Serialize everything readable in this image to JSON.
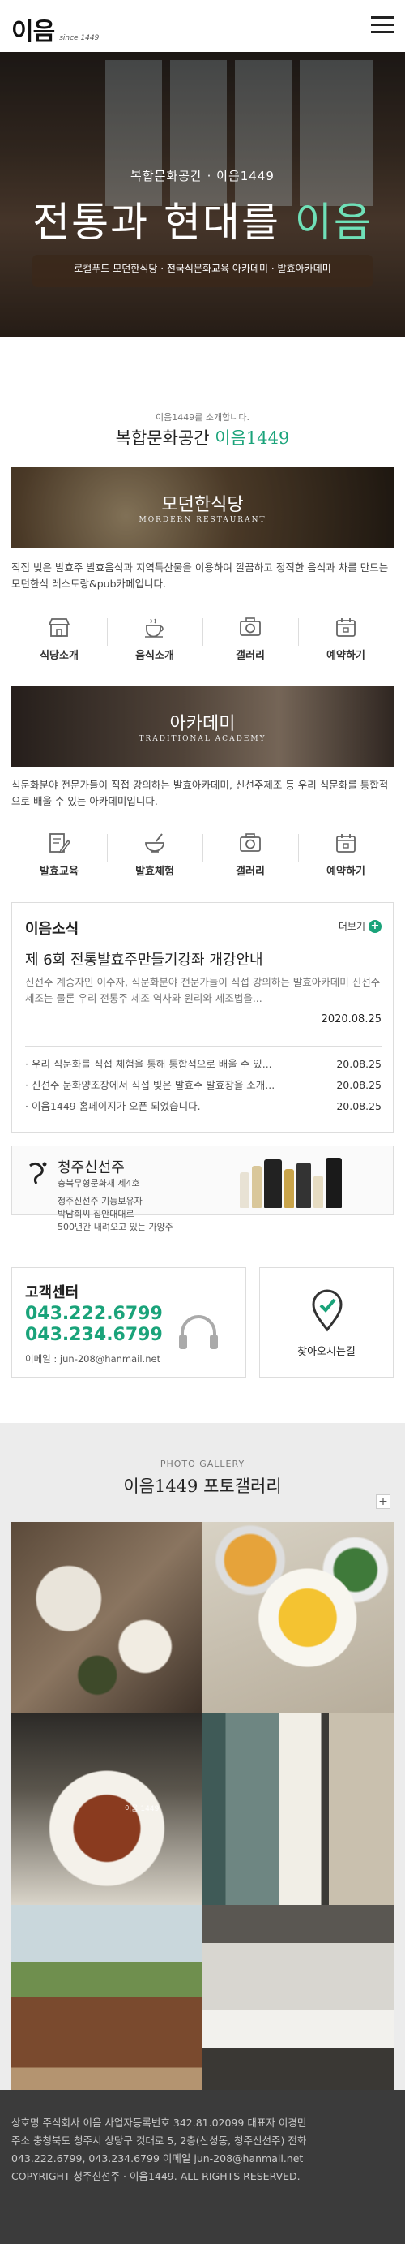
{
  "header": {
    "logo": "이음",
    "logo_sub": "since 1449",
    "menu_icon": "hamburger-menu-icon"
  },
  "hero": {
    "subtitle": "복합문화공간 · 이음1449",
    "title_main": "전통과 현대를 ",
    "title_accent": "이음",
    "description": "로컬푸드 모던한식당 · 전국식문화교육 아카데미 · 발효아카데미"
  },
  "intro": {
    "small": "이음1449를 소개합니다.",
    "title_main": "복합문화공간 ",
    "title_accent": "이음1449"
  },
  "restaurant": {
    "title": "모던한식당",
    "subtitle": "MORDERN RESTAURANT",
    "description": "직접 빚은 발효주 발효음식과 지역특산물을 이용하여 깔끔하고 정직한 음식과 차를 만드는 모던한식 레스토랑&pub카페입니다.",
    "icons": [
      {
        "label": "식당소개",
        "icon": "store-icon"
      },
      {
        "label": "음식소개",
        "icon": "tea-cup-icon"
      },
      {
        "label": "갤러리",
        "icon": "camera-icon"
      },
      {
        "label": "예약하기",
        "icon": "calendar-icon"
      }
    ]
  },
  "academy": {
    "title": "아카데미",
    "subtitle": "TRADITIONAL ACADEMY",
    "description": "식문화분야 전문가들이 직접 강의하는 발효아카데미, 신선주제조 등 우리 식문화를 통합적으로 배울 수 있는 아카데미입니다.",
    "icons": [
      {
        "label": "발효교육",
        "icon": "pencil-note-icon"
      },
      {
        "label": "발효체험",
        "icon": "mortar-bowl-icon"
      },
      {
        "label": "갤러리",
        "icon": "camera-icon"
      },
      {
        "label": "예약하기",
        "icon": "calendar-icon"
      }
    ]
  },
  "news": {
    "heading": "이음소식",
    "more": "더보기",
    "featured": {
      "title": "제 6회 전통발효주만들기강좌 개강안내",
      "body": "신선주 계승자인 이수자, 식문화분야 전문가들이 직접 강의하는 발효아카데미 신선주 제조는 물론 우리 전통주 제조 역사와 원리와 제조법을...",
      "date": "2020.08.25"
    },
    "items": [
      {
        "text": "· 우리 식문화를 직접 체험을 통해 통합적으로 배울 수 있...",
        "date": "20.08.25"
      },
      {
        "text": "· 신선주 문화양조장에서 직접 빚은 발효주 발효장을 소개...",
        "date": "20.08.25"
      },
      {
        "text": "· 이음1449 홈페이지가 오픈 되었습니다.",
        "date": "20.08.25"
      }
    ]
  },
  "product": {
    "title": "청주신선주",
    "line1": "충북무형문화재 제4호",
    "line2": "청주신선주 기능보유자",
    "line3": "박남희씨 집안대대로",
    "line4": "500년간 내려오고 있는 가양주"
  },
  "customer": {
    "title": "고객센터",
    "phone1": "043.222.6799",
    "phone2": "043.234.6799",
    "email": "이메일 : jun-208@hanmail.net",
    "icon": "headset-icon",
    "map_label": "찾아오시는길",
    "map_icon": "map-pin-icon"
  },
  "gallery": {
    "small": "PHOTO GALLERY",
    "title": "이음1449 포토갤러리",
    "plus": "+",
    "watermark": "이음 1449"
  },
  "footer": {
    "line1": "상호명 주식회사 이음 사업자등록번호 342.81.02099 대표자 이경민",
    "line2": "주소 충청북도 청주시 상당구 것대로 5, 2층(산성동, 청주신선주) 전화",
    "line3": "043.222.6799, 043.234.6799 이메일 jun-208@hanmail.net",
    "line4": "COPYRIGHT 청주신선주 · 이음1449. ALL RIGHTS RESERVED."
  },
  "colors": {
    "accent": "#1aa37a",
    "hero_accent": "#6fe0b8",
    "footer_bg": "#3b3b3b"
  }
}
